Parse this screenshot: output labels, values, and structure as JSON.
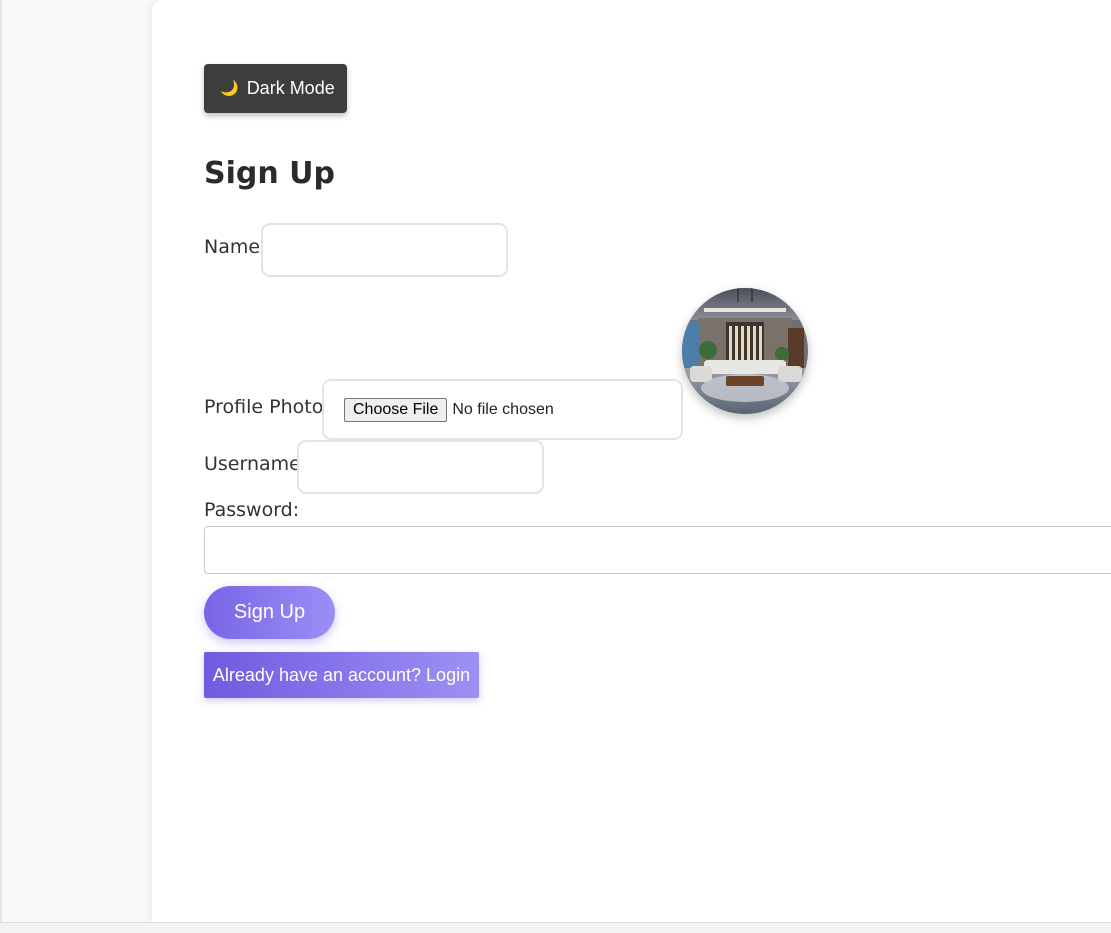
{
  "theme_toggle": {
    "icon": "moon-icon",
    "glyph": "🌙",
    "label": "Dark Mode"
  },
  "form": {
    "title": "Sign Up",
    "name_label": "Name:",
    "name_value": "",
    "profile_photo_label": "Profile Photo:",
    "file_button_label": "Choose File",
    "file_status": "No file chosen",
    "avatar_alt": "",
    "username_label": "Username:",
    "username_value": "",
    "password_label": "Password:",
    "password_value": "",
    "submit_label": "Sign Up",
    "login_link_label": "Already have an account? Login"
  },
  "colors": {
    "accent_start": "#7865e6",
    "accent_end": "#9b8ff5",
    "toggle_bg": "#3d3d3d"
  }
}
